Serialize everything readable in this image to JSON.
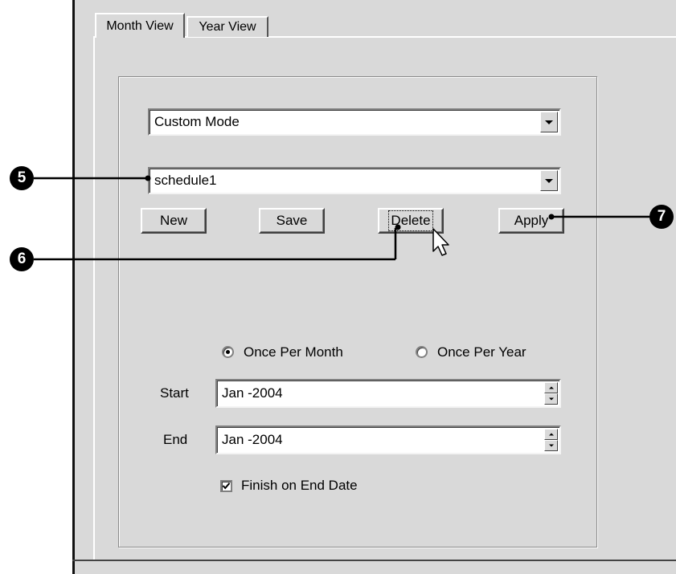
{
  "tabs": [
    {
      "label": "Month View",
      "active": true
    },
    {
      "label": "Year View",
      "active": false
    }
  ],
  "mode_select": {
    "value": "Custom Mode"
  },
  "schedule_select": {
    "value": "schedule1"
  },
  "buttons": {
    "new": "New",
    "save": "Save",
    "delete": "Delete",
    "apply": "Apply"
  },
  "frequency": {
    "once_per_month": "Once Per Month",
    "once_per_year": "Once Per Year",
    "selected": "once_per_month"
  },
  "start": {
    "label": "Start",
    "value": "Jan -2004"
  },
  "end": {
    "label": "End",
    "value": "Jan -2004"
  },
  "finish_on_end_date": {
    "label": "Finish on End Date",
    "checked": true
  },
  "callouts": {
    "schedule": "5",
    "delete": "6",
    "apply": "7"
  },
  "icons": {
    "dropdown": "chevron-down-icon",
    "spin_up": "spin-up-icon",
    "spin_down": "spin-down-icon",
    "cursor": "mouse-pointer-icon"
  }
}
